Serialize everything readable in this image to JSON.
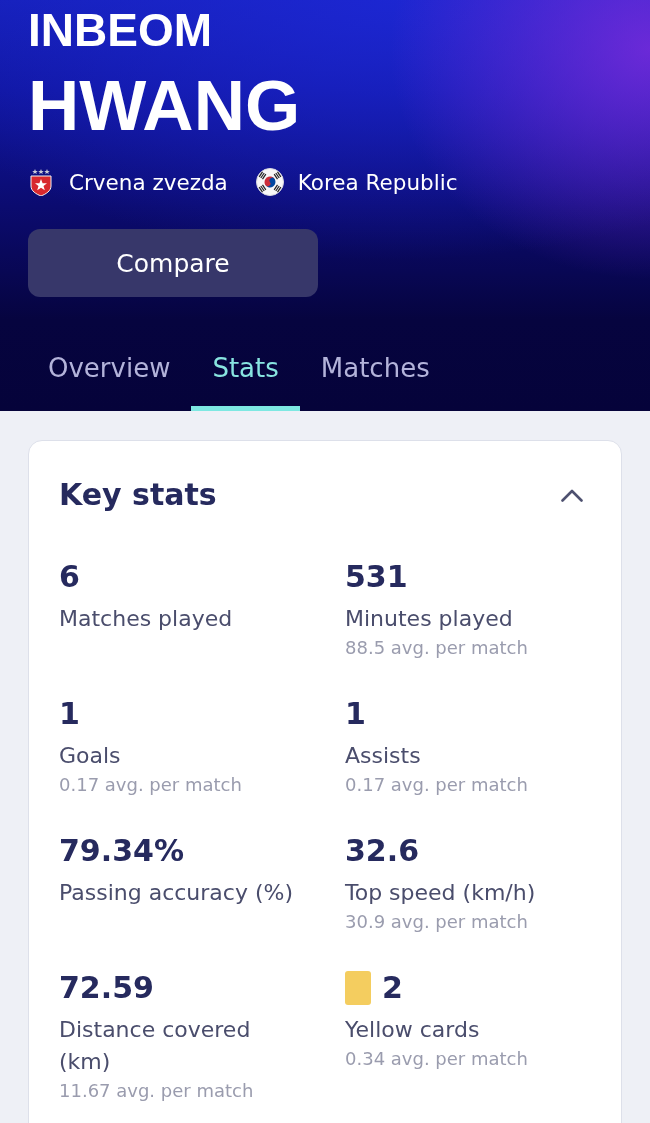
{
  "player": {
    "first_name": "INBEOM",
    "last_name": "HWANG",
    "club": "Crvena zvezda",
    "nationality": "Korea Republic"
  },
  "compare_button": "Compare",
  "tabs": [
    {
      "label": "Overview",
      "selected": false
    },
    {
      "label": "Stats",
      "selected": true
    },
    {
      "label": "Matches",
      "selected": false
    }
  ],
  "key_stats": {
    "title": "Key stats",
    "expanded": true,
    "stats": [
      {
        "kind": "number",
        "value": "6",
        "label": "Matches played"
      },
      {
        "kind": "number",
        "value": "531",
        "label": "Minutes played",
        "average": "88.5 avg. per match"
      },
      {
        "kind": "number",
        "value": "1",
        "label": "Goals",
        "average": "0.17 avg. per match"
      },
      {
        "kind": "number",
        "value": "1",
        "label": "Assists",
        "average": "0.17 avg. per match"
      },
      {
        "kind": "number",
        "value": "79.34%",
        "label": "Passing accuracy (%)"
      },
      {
        "kind": "number",
        "value": "32.6",
        "label": "Top speed (km/h)",
        "average": "30.9 avg. per match"
      },
      {
        "kind": "number",
        "value": "72.59",
        "label": "Distance covered (km)",
        "average": "11.67 avg. per match"
      },
      {
        "kind": "yellow_card",
        "value": "2",
        "label": "Yellow cards",
        "average": "0.34 avg. per match"
      }
    ]
  }
}
